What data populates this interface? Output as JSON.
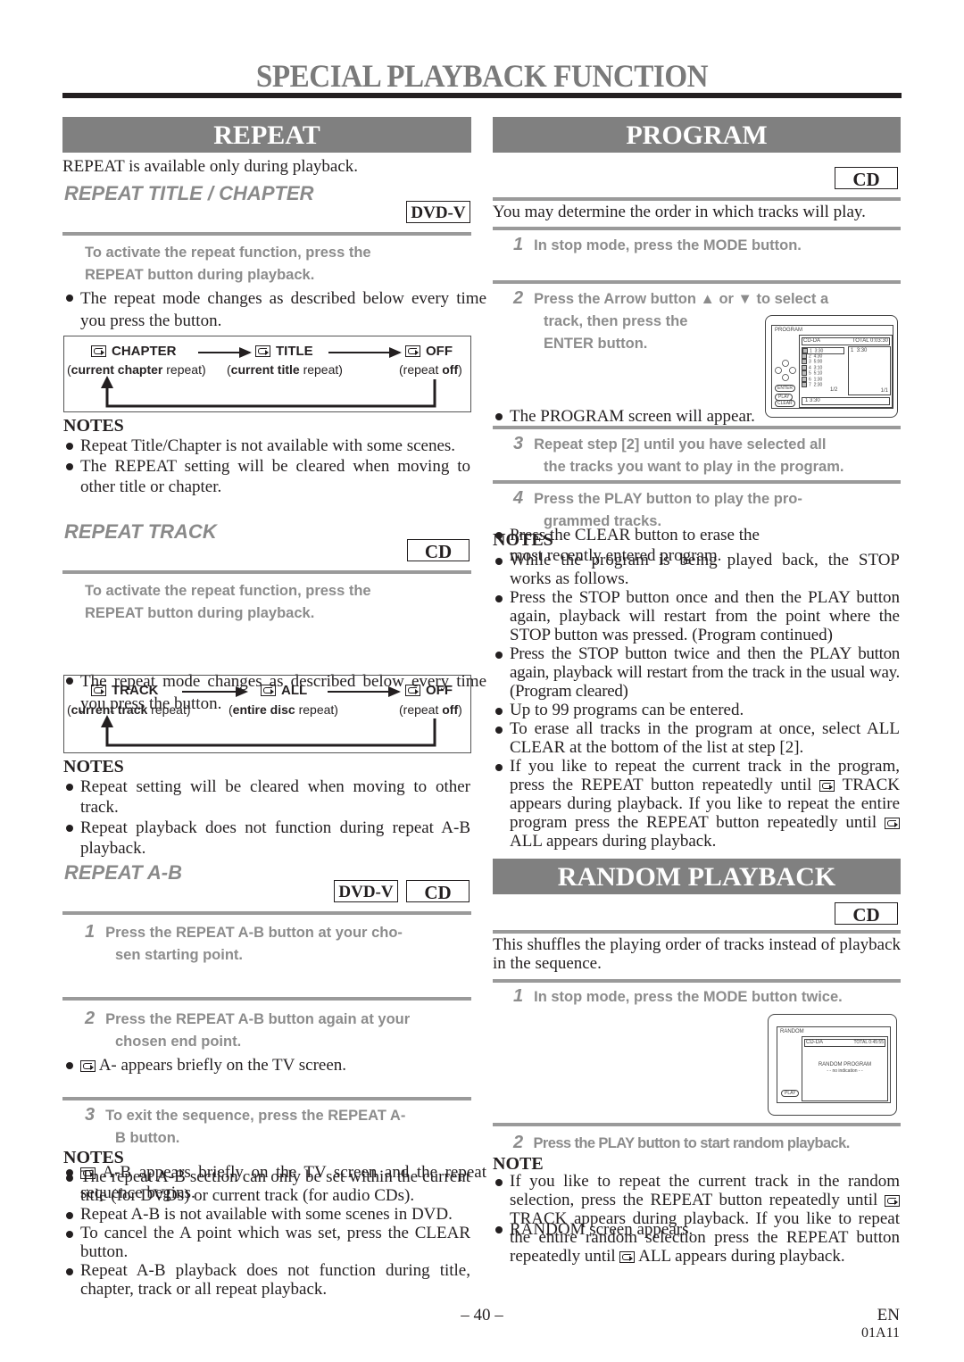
{
  "page": {
    "title": "SPECIAL PLAYBACK FUNCTION",
    "page_number": "– 40 –",
    "language": "EN",
    "code": "01A11"
  },
  "repeat": {
    "heading": "REPEAT",
    "intro": "REPEAT is available only during playback.",
    "title_chapter": {
      "subheading": "REPEAT TITLE / CHAPTER",
      "badge": "DVD-V",
      "instruction_line1": "To activate the repeat function, press the",
      "instruction_line2": "REPEAT button during playback.",
      "bullet": "The repeat mode changes as described below every time you press the button.",
      "diagram": {
        "modes": [
          {
            "label": "CHAPTER",
            "bold": "current chapter",
            "plain_before": "(",
            "plain_after": " repeat)"
          },
          {
            "label": "TITLE",
            "bold": "current title",
            "plain_before": "(",
            "plain_after": " repeat)"
          },
          {
            "label": "OFF",
            "bold": "off",
            "plain_before": "(repeat ",
            "plain_after": ")"
          }
        ]
      },
      "notes_heading": "NOTES",
      "notes": [
        "Repeat Title/Chapter is not available with some scenes.",
        "The REPEAT setting will be cleared when moving to other title or chapter."
      ]
    },
    "track": {
      "subheading": "REPEAT TRACK",
      "badge": "CD",
      "instruction_line1": "To activate the repeat function, press the",
      "instruction_line2": "REPEAT button during playback.",
      "bullet": "The repeat mode changes as described below every time you press the button.",
      "diagram": {
        "modes": [
          {
            "label": "TRACK",
            "bold": "current track",
            "plain_before": "(",
            "plain_after": " repeat)"
          },
          {
            "label": "ALL",
            "bold": "entire disc",
            "plain_before": "(",
            "plain_after": " repeat)"
          },
          {
            "label": "OFF",
            "bold": "off",
            "plain_before": "(repeat ",
            "plain_after": ")"
          }
        ]
      },
      "notes_heading": "NOTES",
      "notes": [
        "Repeat setting will be cleared when moving to other track.",
        "Repeat playback does not function during repeat A-B playback."
      ]
    },
    "ab": {
      "subheading": "REPEAT A-B",
      "badges": [
        "DVD-V",
        "CD"
      ],
      "steps": [
        {
          "num": "1",
          "line1": "Press the REPEAT A-B button at your cho-",
          "line2": "sen starting point.",
          "bullet": "A- appears briefly on the TV screen."
        },
        {
          "num": "2",
          "line1": "Press the REPEAT A-B button again at your",
          "line2": "chosen end point.",
          "bullet": "A-B appears briefly on the TV screen and the repeat sequence begins."
        },
        {
          "num": "3",
          "line1": "To exit the sequence, press the REPEAT A-",
          "line2": "B button."
        }
      ],
      "notes_heading": "NOTES",
      "notes": [
        "The repeat A-B section can only be set within the current title (for DVDs) or current track (for audio CDs).",
        "Repeat A-B is not available with some scenes in DVD.",
        "To cancel the A point which was set, press the CLEAR button.",
        "Repeat A-B playback does not function during title, chapter, track or all repeat playback."
      ]
    }
  },
  "program": {
    "heading": "PROGRAM",
    "badge": "CD",
    "intro": "You may determine the order in which tracks will play.",
    "steps": [
      {
        "num": "1",
        "line1": "In stop mode, press the MODE button.",
        "bullet": "The PROGRAM screen will appear."
      },
      {
        "num": "2",
        "line1": "Press the Arrow button ▲ or ▼ to select a",
        "line2": "track, then press the",
        "line3": "ENTER button.",
        "bullet": "Press the CLEAR button to erase the most recently entered program."
      },
      {
        "num": "3",
        "line1": "Repeat step [2] until you have selected all",
        "line2": "the tracks you want to play in the program."
      },
      {
        "num": "4",
        "line1": "Press the PLAY button to play the pro-",
        "line2": "grammed tracks."
      }
    ],
    "screen": {
      "title": "PROGRAM",
      "disc": "CD-DA",
      "total": "TOTAL 0:03:30",
      "tracks": [
        {
          "n": "1",
          "t": "3:30"
        },
        {
          "n": "2",
          "t": "4:30"
        },
        {
          "n": "3",
          "t": "5:00"
        },
        {
          "n": "4",
          "t": "3:10"
        },
        {
          "n": "5",
          "t": "5:10"
        },
        {
          "n": "6",
          "t": "1:30"
        },
        {
          "n": "7",
          "t": "2:30"
        }
      ],
      "track_page": "1/2",
      "program_list": [
        {
          "n": "1",
          "t": "3:30"
        }
      ],
      "program_page": "1/1",
      "current": "1  3:30",
      "buttons": [
        "ENTER",
        "PLAY",
        "CLEAR"
      ]
    },
    "notes_heading": "NOTES",
    "notes": [
      "While the program is being played back, the STOP works as follows.",
      "Press the STOP button once and then the PLAY button again, playback will restart from the point where the STOP button was pressed. (Program continued)",
      "Press the STOP button twice and then the PLAY button again, playback will restart from the track in the usual way. (Program cleared)",
      "Up to 99 programs can be entered.",
      "To erase all tracks in the program at once, select ALL CLEAR at the bottom of the list at step [2]."
    ],
    "repeat_note": {
      "part1": "If you like to repeat the current track in the program, press the REPEAT button repeatedly until",
      "part2": "TRACK appears during playback. If you like to repeat the entire program press the REPEAT button repeatedly until",
      "part3": "ALL appears during playback."
    }
  },
  "random": {
    "heading": "RANDOM PLAYBACK",
    "badge": "CD",
    "intro": "This shuffles the playing order of tracks instead of playback in the sequence.",
    "steps": [
      {
        "num": "1",
        "line1": "In stop mode, press the MODE button twice.",
        "bullet": "RANDOM screen appears."
      },
      {
        "num": "2",
        "line1": "Press the PLAY button to start random playback."
      }
    ],
    "screen": {
      "title": "RANDOM",
      "disc": "CD-DA",
      "total": "TOTAL 0:45:55",
      "message": "RANDOM PROGRAM",
      "sub_message": "- - no indication - -",
      "button": "PLAY"
    },
    "notes_heading": "NOTE",
    "note": {
      "part1": "If you like to repeat the current track in the random selection, press the REPEAT button repeatedly until",
      "part2": "TRACK appears during playback. If you like to repeat the entire random selection press the REPEAT button repeatedly until",
      "part3": "ALL appears during playback."
    }
  }
}
